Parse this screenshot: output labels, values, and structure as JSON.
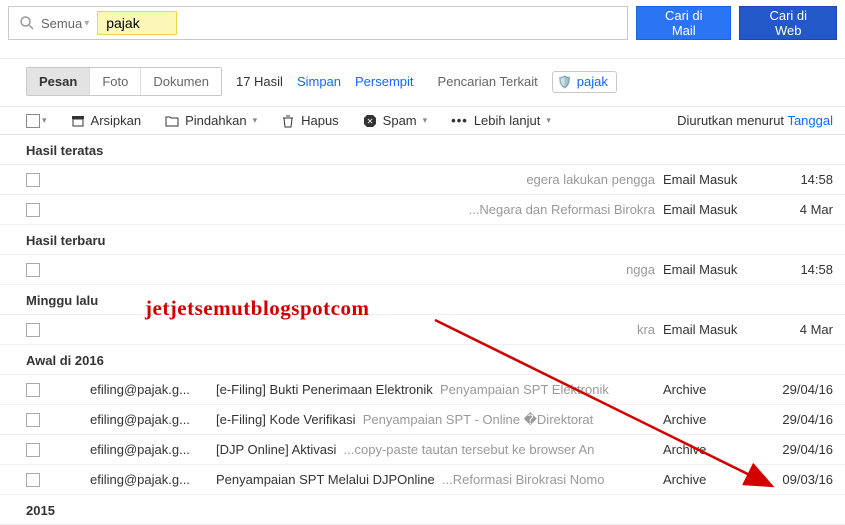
{
  "search": {
    "scope": "Semua",
    "value": "pajak",
    "btn_mail": "Cari di Mail",
    "btn_web": "Cari di Web"
  },
  "filters": {
    "tab_pesan": "Pesan",
    "tab_foto": "Foto",
    "tab_dokumen": "Dokumen",
    "count": "17 Hasil",
    "simpan": "Simpan",
    "persempit": "Persempit",
    "terkait": "Pencarian Terkait",
    "chip_label": "pajak"
  },
  "toolbar": {
    "arsipkan": "Arsipkan",
    "pindahkan": "Pindahkan",
    "hapus": "Hapus",
    "spam": "Spam",
    "lebih": "Lebih lanjut",
    "sort_prefix": "Diurutkan menurut",
    "sort_value": "Tanggal"
  },
  "sections": {
    "teratas": "Hasil teratas",
    "terbaru": "Hasil terbaru",
    "minggu_lalu": "Minggu lalu",
    "awal_2016": "Awal di 2016",
    "y2015": "2015"
  },
  "rows": {
    "teratas": [
      {
        "subject_snippet": "egera lakukan pengga",
        "folder": "Email Masuk",
        "date": "14:58"
      },
      {
        "subject_snippet": "...Negara dan Reformasi Birokra",
        "folder": "Email Masuk",
        "date": "4 Mar"
      }
    ],
    "terbaru": [
      {
        "subject_snippet": "ngga",
        "folder": "Email Masuk",
        "date": "14:58"
      }
    ],
    "minggu_lalu": [
      {
        "subject_snippet": "kra",
        "folder": "Email Masuk",
        "date": "4 Mar"
      }
    ],
    "awal_2016": [
      {
        "from": "efiling@pajak.g...",
        "subject": "[e-Filing] Bukti Penerimaan Elektronik",
        "snippet": "Penyampaian SPT Elektronik",
        "folder": "Archive",
        "date": "29/04/16"
      },
      {
        "from": "efiling@pajak.g...",
        "subject": "[e-Filing] Kode Verifikasi",
        "snippet": "Penyampaian SPT - Online �Direktorat",
        "folder": "Archive",
        "date": "29/04/16"
      },
      {
        "from": "efiling@pajak.g...",
        "subject": "[DJP Online] Aktivasi",
        "snippet": "...copy-paste tautan tersebut ke browser An",
        "folder": "Archive",
        "date": "29/04/16"
      },
      {
        "from": "efiling@pajak.g...",
        "subject": "Penyampaian SPT Melalui DJPOnline",
        "snippet": "...Reformasi Birokrasi Nomo",
        "folder": "Archive",
        "date": "09/03/16"
      }
    ]
  },
  "watermark": "jetjetsemutblogspotcom"
}
